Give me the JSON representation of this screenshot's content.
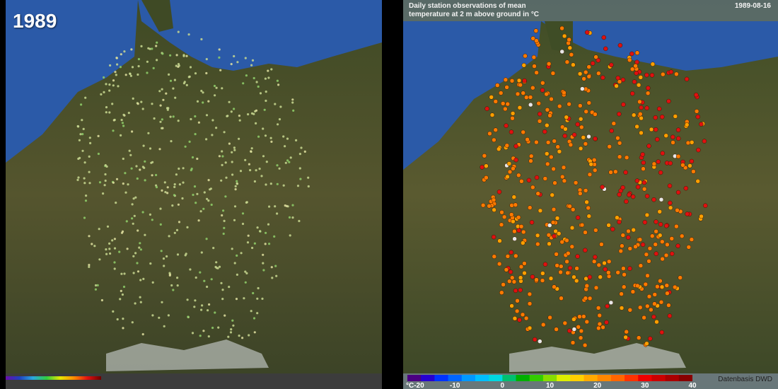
{
  "left_panel": {
    "year": "1989"
  },
  "right_panel": {
    "title_line1": "Daily station observations of mean",
    "title_line2": "temperature at 2 m above ground in °C",
    "date": "1989-08-16",
    "source": "Datenbasis DWD",
    "colorbar": {
      "unit": "°C",
      "ticks": [
        "-20",
        "-10",
        "0",
        "10",
        "20",
        "30",
        "40"
      ],
      "min": -20,
      "max": 40,
      "colors": [
        "#4b0082",
        "#2600d0",
        "#0033ff",
        "#0066ff",
        "#0099ff",
        "#00bfff",
        "#00d8e0",
        "#00c070",
        "#00b000",
        "#33cc00",
        "#88dd00",
        "#ddee00",
        "#ffd000",
        "#ffaa00",
        "#ff8800",
        "#ff6600",
        "#ff3300",
        "#ee0000",
        "#cc0000",
        "#aa0000",
        "#880000"
      ]
    }
  },
  "colors": {
    "sea": "#2b5aa8",
    "land": "#4a5a2a",
    "left_station": "#c8d890",
    "right_station_warm": "#ff7a00",
    "right_station_hot": "#e01010",
    "right_station_missing": "#e8e8e8"
  }
}
